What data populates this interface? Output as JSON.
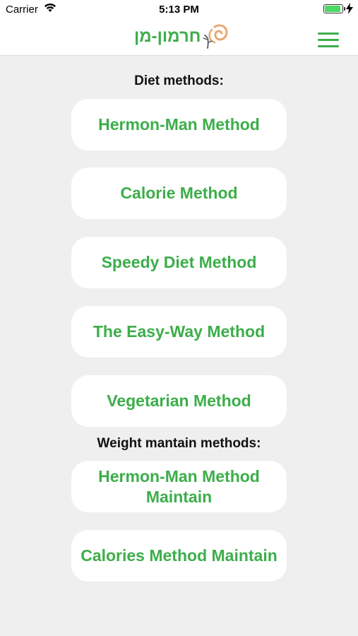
{
  "status_bar": {
    "carrier": "Carrier",
    "time": "5:13 PM",
    "battery_level": 1.0,
    "battery_color": "#4cd964"
  },
  "header": {
    "logo_text": "חרמון-מן",
    "logo_text_color": "#3cae4a",
    "logo_mark_color": "#e8a872",
    "menu_icon": "hamburger-menu-icon",
    "accent_color": "#3cae4a"
  },
  "diet_section": {
    "title": "Diet methods:",
    "methods": [
      {
        "label": "Hermon-Man Method"
      },
      {
        "label": "Calorie Method"
      },
      {
        "label": "Speedy Diet Method"
      },
      {
        "label": "The Easy-Way Method"
      },
      {
        "label": "Vegetarian Method"
      }
    ]
  },
  "maintain_section": {
    "title": "Weight mantain methods:",
    "methods": [
      {
        "label": "Hermon-Man Method Maintain"
      },
      {
        "label": "Calories Method Maintain"
      }
    ]
  },
  "colors": {
    "button_text": "#3cae4a",
    "background": "#efefef",
    "button_bg": "#ffffff"
  }
}
